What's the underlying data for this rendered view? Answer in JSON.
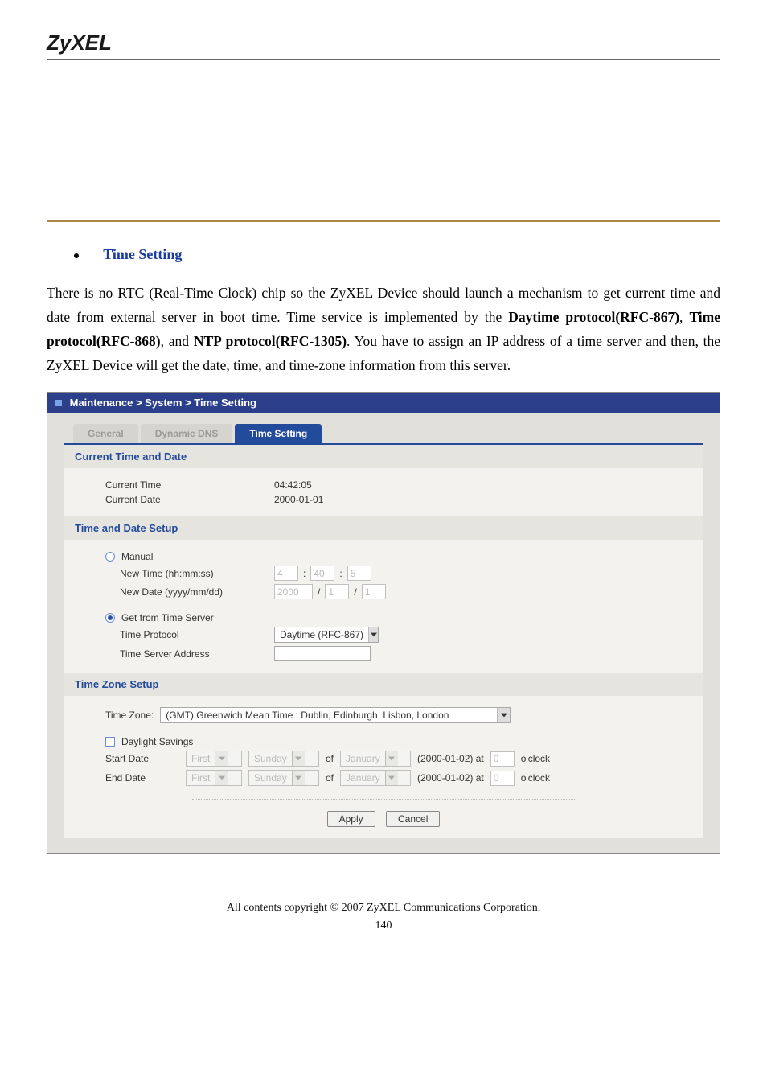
{
  "brand": "ZyXEL",
  "heading_prefix": "• ",
  "heading": "Time Setting",
  "paragraph_pre": "There is no RTC (Real-Time Clock) chip so the ZyXEL Device should launch a mechanism to get current time and date from external server in boot time. Time service is implemented by the ",
  "proto1": "Daytime protocol(RFC-867)",
  "sep1": ", ",
  "proto2": "Time protocol(RFC-868)",
  "sep2": ", and ",
  "proto3": "NTP protocol(RFC-1305)",
  "paragraph_post": ". You have to assign an IP address of a time server and then, the ZyXEL Device will get the date, time, and time-zone information from this server.",
  "shot": {
    "breadcrumb": "Maintenance > System > Time Setting",
    "tabs": {
      "general": "General",
      "ddns": "Dynamic DNS",
      "time": "Time Setting"
    },
    "sec1": {
      "title": "Current Time and Date",
      "row1_label": "Current Time",
      "row1_value": "04:42:05",
      "row2_label": "Current Date",
      "row2_value": "2000-01-01"
    },
    "sec2": {
      "title": "Time and Date Setup",
      "manual": "Manual",
      "newtime_label": "New Time (hh:mm:ss)",
      "hh": "4",
      "mm": "40",
      "ss": "5",
      "newdate_label": "New Date (yyyy/mm/dd)",
      "yyyy": "2000",
      "mo": "1",
      "dd": "1",
      "server": "Get from Time Server",
      "proto_label": "Time Protocol",
      "proto_value": "Daytime (RFC-867)",
      "addr_label": "Time Server Address",
      "addr_value": ""
    },
    "sec3": {
      "title": "Time Zone Setup",
      "tz_label": "Time Zone:",
      "tz_value": "(GMT) Greenwich Mean Time : Dublin, Edinburgh, Lisbon, London",
      "dst": "Daylight Savings",
      "start_label": "Start Date",
      "end_label": "End Date",
      "ord": "First",
      "day": "Sunday",
      "of": "of",
      "month": "January",
      "rng": "(2000-01-02)  at",
      "hour": "0",
      "oclock": "o'clock"
    },
    "buttons": {
      "apply": "Apply",
      "cancel": "Cancel"
    }
  },
  "footer": {
    "line": "All contents copyright © 2007 ZyXEL Communications Corporation.",
    "page": "140"
  }
}
